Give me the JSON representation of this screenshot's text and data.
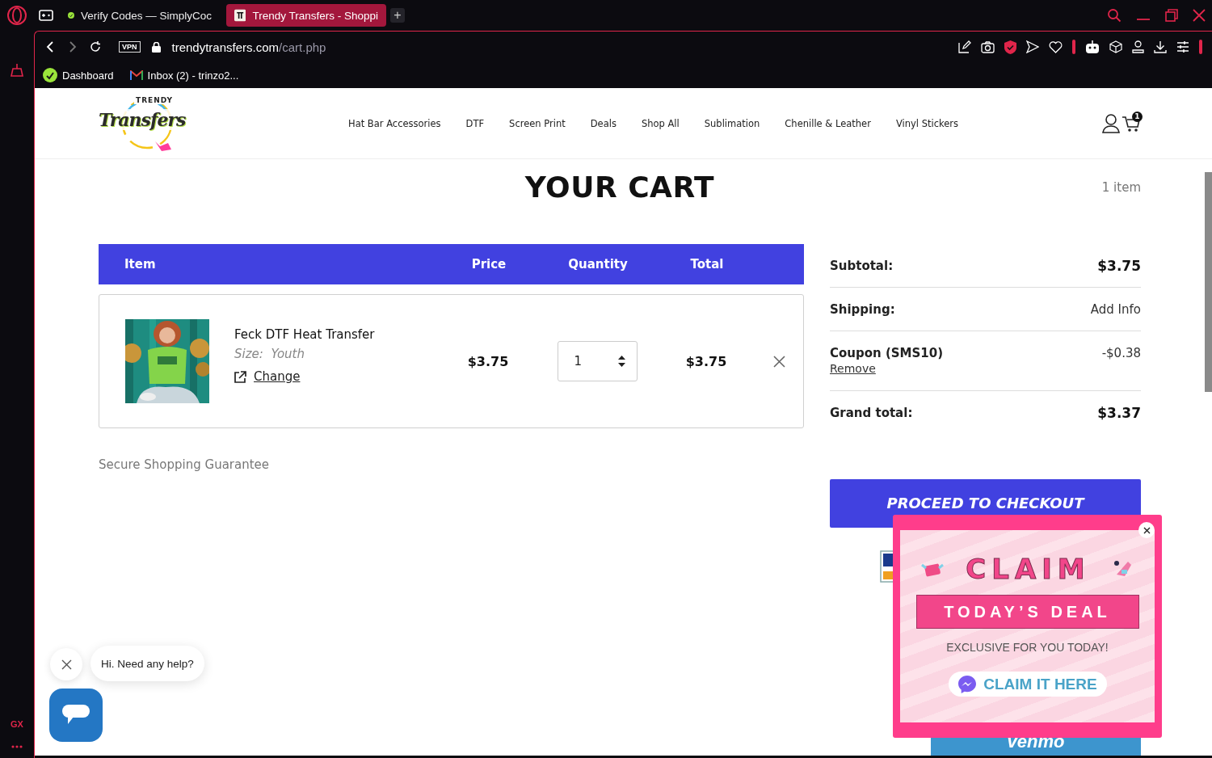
{
  "browser": {
    "tabs": [
      {
        "title": "Verify Codes — SimplyCoc",
        "selected": false
      },
      {
        "title": "Trendy Transfers - Shoppi",
        "selected": true
      }
    ],
    "new_tab": "+",
    "vpn_badge": "VPN",
    "address": {
      "domain": "trendytransfers.com",
      "path": "/cart.php"
    },
    "bookmarks": [
      {
        "label": "Dashboard",
        "kind": "app"
      },
      {
        "label": "Inbox (2) - trinzo2...",
        "kind": "mail"
      }
    ],
    "sidebar_label": "GX"
  },
  "site": {
    "logo": {
      "top": "TRENDY",
      "main": "Transfers"
    },
    "nav": [
      "Hat Bar Accessories",
      "DTF",
      "Screen Print",
      "Deals",
      "Shop All",
      "Sublimation",
      "Chenille & Leather",
      "Vinyl Stickers"
    ],
    "cart_count": "1"
  },
  "cart": {
    "title": "YOUR CART",
    "item_count": "1 item",
    "columns": [
      "Item",
      "Price",
      "Quantity",
      "Total"
    ],
    "items": [
      {
        "name": "Feck DTF Heat Transfer",
        "size": "Size:  Youth",
        "change": "Change",
        "price": "$3.75",
        "quantity": "1",
        "total": "$3.75"
      }
    ],
    "guarantee": "Secure Shopping Guarantee"
  },
  "summary": {
    "rows": [
      {
        "kind": "amount",
        "label": "Subtotal:",
        "value": "$3.75"
      },
      {
        "kind": "info",
        "label": "Shipping:",
        "value": "Add Info"
      },
      {
        "kind": "coupon",
        "label": "Coupon (SMS10)",
        "value": "-$0.38",
        "link": "Remove"
      },
      {
        "kind": "amount",
        "label": "Grand total:",
        "value": "$3.37"
      }
    ],
    "checkout": "PROCEED TO CHECKOUT",
    "venmo": "venmo"
  },
  "popup": {
    "headline": "CLAIM",
    "banner": "TODAY’S DEAL",
    "subtitle": "EXCLUSIVE FOR YOU TODAY!",
    "button": "CLAIM IT HERE"
  },
  "chat": {
    "greeting": "Hi. Need any help?"
  }
}
